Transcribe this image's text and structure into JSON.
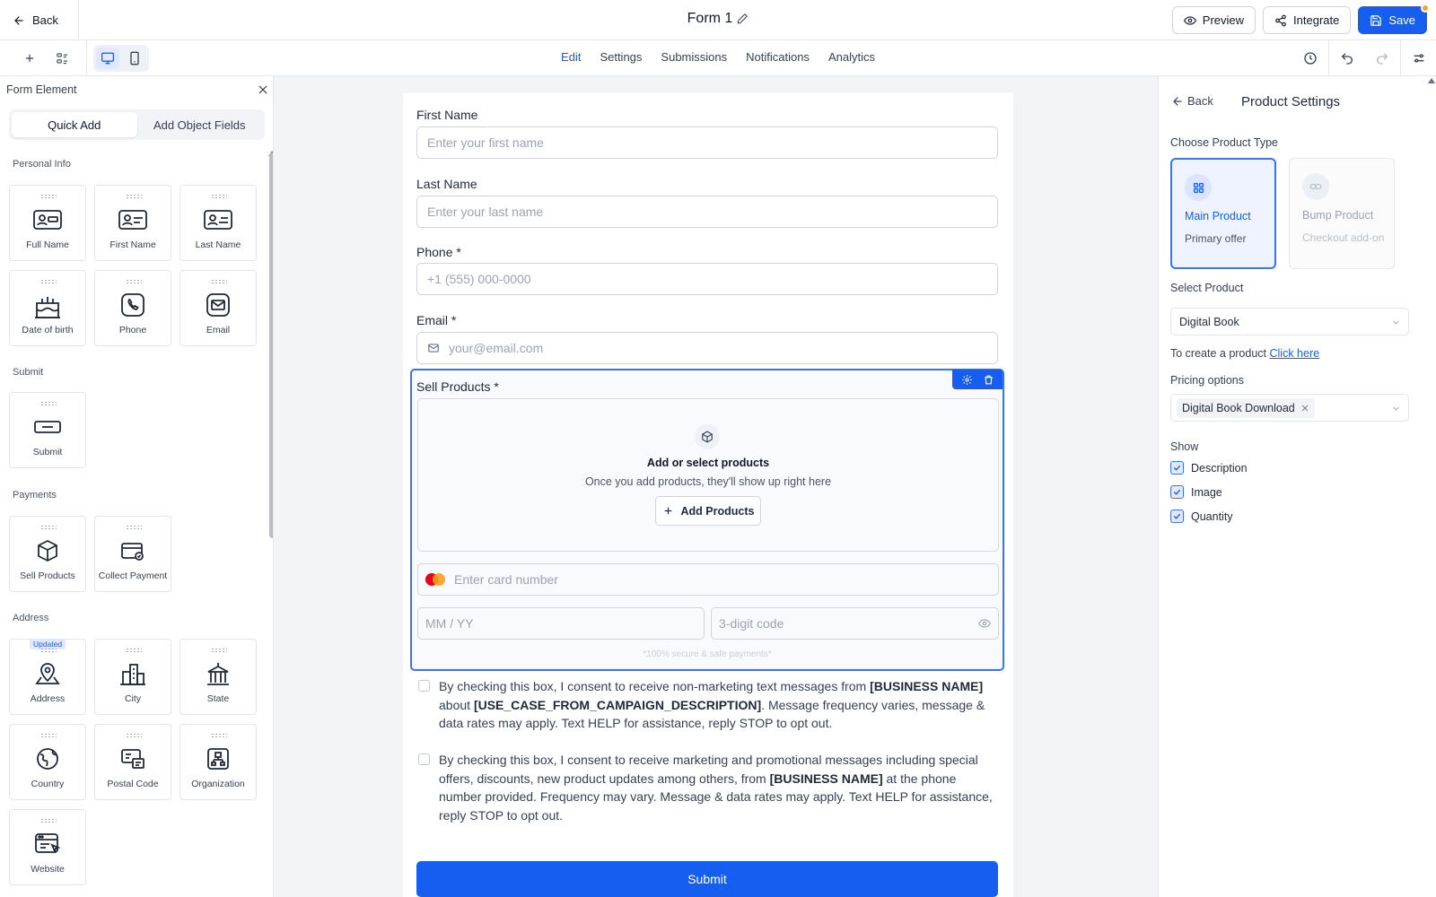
{
  "header": {
    "back_label": "Back",
    "form_title": "Form 1",
    "preview_label": "Preview",
    "integrate_label": "Integrate",
    "save_label": "Save"
  },
  "toolbar": {
    "tabs": [
      {
        "label": "Edit",
        "active": true
      },
      {
        "label": "Settings",
        "active": false
      },
      {
        "label": "Submissions",
        "active": false
      },
      {
        "label": "Notifications",
        "active": false
      },
      {
        "label": "Analytics",
        "active": false
      }
    ]
  },
  "left_panel": {
    "title": "Form Element",
    "segments": [
      "Quick Add",
      "Add Object Fields"
    ],
    "sections": {
      "personal": {
        "title": "Personal Info",
        "items": [
          "Full Name",
          "First Name",
          "Last Name",
          "Date of birth",
          "Phone",
          "Email"
        ]
      },
      "submit": {
        "title": "Submit",
        "items": [
          "Submit"
        ]
      },
      "payments": {
        "title": "Payments",
        "items": [
          "Sell Products",
          "Collect Payment"
        ]
      },
      "address": {
        "title": "Address",
        "items": [
          "Address",
          "City",
          "State",
          "Country",
          "Postal Code",
          "Organization",
          "Website"
        ],
        "badge": "Updated"
      }
    }
  },
  "form": {
    "fields": [
      {
        "label": "First Name",
        "placeholder": "Enter your first name"
      },
      {
        "label": "Last Name",
        "placeholder": "Enter your last name"
      },
      {
        "label": "Phone *",
        "placeholder": "+1 (555) 000-0000"
      },
      {
        "label": "Email *",
        "placeholder": "your@email.com"
      }
    ],
    "sell_products": {
      "label": "Sell Products *",
      "empty_title": "Add or select products",
      "empty_sub": "Once you add products, they'll show up right here",
      "add_button": "Add Products",
      "card_placeholder": "Enter card number",
      "expiry_placeholder": "MM / YY",
      "cvc_placeholder": "3-digit code",
      "secure_note": "*100% secure & safe payments*"
    },
    "consent_1": {
      "p1": "By checking this box, I consent to receive non-marketing text messages from ",
      "b1": "[BUSINESS NAME]",
      "p2": " about ",
      "b2": "[USE_CASE_FROM_CAMPAIGN_DESCRIPTION]",
      "p3": ". Message frequency varies, message & data rates may apply. Text HELP for assistance, reply STOP to opt out."
    },
    "consent_2": {
      "p1": "By checking this box, I consent to receive marketing and promotional messages including special offers, discounts, new product updates among others, from ",
      "b1": "[BUSINESS NAME]",
      "p2": " at the phone number provided. Frequency may vary. Message & data rates may apply. Text HELP for assistance, reply STOP to opt out."
    },
    "submit_label": "Submit"
  },
  "right_panel": {
    "back_label": "Back",
    "title": "Product Settings",
    "product_type_label": "Choose Product Type",
    "main_product": {
      "name": "Main Product",
      "desc": "Primary offer"
    },
    "bump_product": {
      "name": "Bump Product",
      "desc": "Checkout add-on"
    },
    "select_product_label": "Select Product",
    "selected_product": "Digital Book",
    "create_hint": "To create a product ",
    "create_link": "Click here",
    "pricing_label": "Pricing options",
    "pricing_chip": "Digital Book Download",
    "show_label": "Show",
    "show_options": [
      {
        "label": "Description",
        "checked": true
      },
      {
        "label": "Image",
        "checked": true
      },
      {
        "label": "Quantity",
        "checked": true
      }
    ]
  },
  "colors": {
    "accent": "#155eef",
    "save_dot": "#f5a524"
  }
}
